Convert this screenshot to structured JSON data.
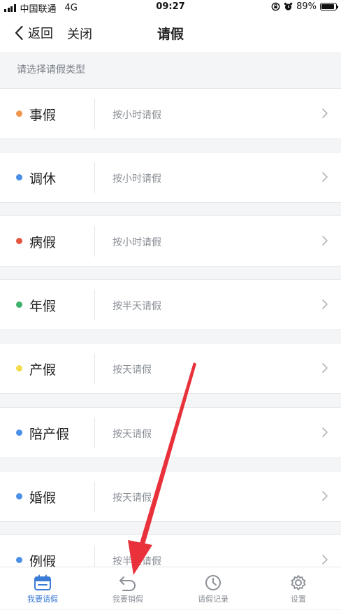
{
  "status_bar": {
    "carrier": "中国联通",
    "network": "4G",
    "time": "09:27",
    "battery": "89%",
    "battery_level": 0.89
  },
  "nav": {
    "back_label": "返回",
    "close_label": "关闭",
    "title": "请假"
  },
  "section_header": "请选择请假类型",
  "leave_types": [
    {
      "name": "事假",
      "rule": "按小时请假",
      "color": "#f0954a"
    },
    {
      "name": "调休",
      "rule": "按小时请假",
      "color": "#4a8fe8"
    },
    {
      "name": "病假",
      "rule": "按小时请假",
      "color": "#e5543d"
    },
    {
      "name": "年假",
      "rule": "按半天请假",
      "color": "#3fb26b"
    },
    {
      "name": "产假",
      "rule": "按天请假",
      "color": "#f2dc4a"
    },
    {
      "name": "陪产假",
      "rule": "按天请假",
      "color": "#4a8fe8"
    },
    {
      "name": "婚假",
      "rule": "按天请假",
      "color": "#4a8fe8"
    },
    {
      "name": "例假",
      "rule": "按半天请假",
      "color": "#4a8fe8"
    }
  ],
  "tabs": [
    {
      "label": "我要请假",
      "icon": "calendar-icon",
      "active": true
    },
    {
      "label": "我要销假",
      "icon": "undo-icon",
      "active": false
    },
    {
      "label": "请假记录",
      "icon": "clock-icon",
      "active": false
    },
    {
      "label": "设置",
      "icon": "gear-icon",
      "active": false
    }
  ],
  "colors": {
    "accent": "#3a7bd5",
    "annotation_arrow": "#e8313b"
  }
}
